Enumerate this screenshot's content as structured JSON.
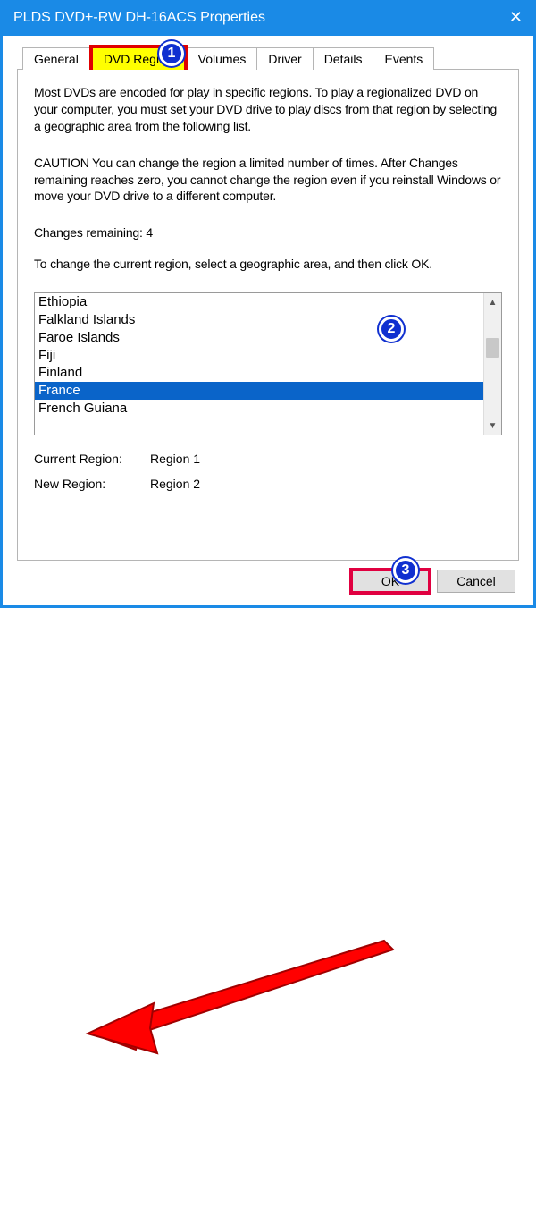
{
  "window": {
    "title": "PLDS DVD+-RW DH-16ACS Properties"
  },
  "tabs": {
    "items": [
      "General",
      "DVD Region",
      "Volumes",
      "Driver",
      "Details",
      "Events"
    ],
    "active_index": 1
  },
  "body": {
    "intro": "Most DVDs are encoded for play in specific regions. To play a regionalized DVD on your computer, you must set your DVD drive to play discs from that region by selecting a geographic area from the following list.",
    "caution": "CAUTION   You can change the region a limited number of times. After Changes remaining reaches zero, you cannot change the region even if you reinstall Windows or move your DVD drive to a different computer.",
    "changes_remaining": "Changes remaining: 4",
    "instruction": "To change the current region, select a geographic area, and then click OK."
  },
  "listbox": {
    "items": [
      "Ethiopia",
      "Falkland Islands",
      "Faroe Islands",
      "Fiji",
      "Finland",
      "France",
      "French Guiana"
    ],
    "selected_index": 5
  },
  "region": {
    "current_label": "Current Region:",
    "current_value": "Region 1",
    "new_label": "New Region:",
    "new_value": "Region 2"
  },
  "buttons": {
    "ok": "OK",
    "cancel": "Cancel"
  },
  "annotations": {
    "b1": "1",
    "b2": "2",
    "b3": "3"
  }
}
